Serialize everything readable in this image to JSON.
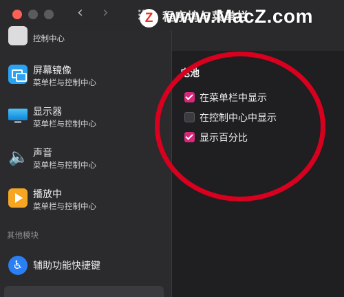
{
  "window": {
    "title": "程序坞与菜单栏",
    "back_glyph": "‹",
    "forward_glyph": "›"
  },
  "watermark": {
    "logo_letter": "Z",
    "text": "www.MacZ.com",
    "color": "#e2332a"
  },
  "sidebar": {
    "partial_top_sub": "控制中心",
    "items": [
      {
        "title": "屏幕镜像",
        "sub": "菜单栏与控制中心",
        "icon": "screen-mirroring-icon"
      },
      {
        "title": "显示器",
        "sub": "菜单栏与控制中心",
        "icon": "display-icon"
      },
      {
        "title": "声音",
        "sub": "菜单栏与控制中心",
        "icon": "speaker-icon",
        "glyph": "🔈"
      },
      {
        "title": "播放中",
        "sub": "菜单栏与控制中心",
        "icon": "now-playing-icon"
      }
    ],
    "section_label": "其他模块",
    "other_items": [
      {
        "title": "辅助功能快捷键",
        "icon": "accessibility-icon",
        "glyph": "♿"
      }
    ]
  },
  "content": {
    "section_title": "电池",
    "options": [
      {
        "label": "在菜单栏中显示",
        "checked": true
      },
      {
        "label": "在控制中心中显示",
        "checked": false
      },
      {
        "label": "显示百分比",
        "checked": true
      }
    ]
  },
  "colors": {
    "accent": "#d6287a",
    "annotation": "#d8001f"
  }
}
